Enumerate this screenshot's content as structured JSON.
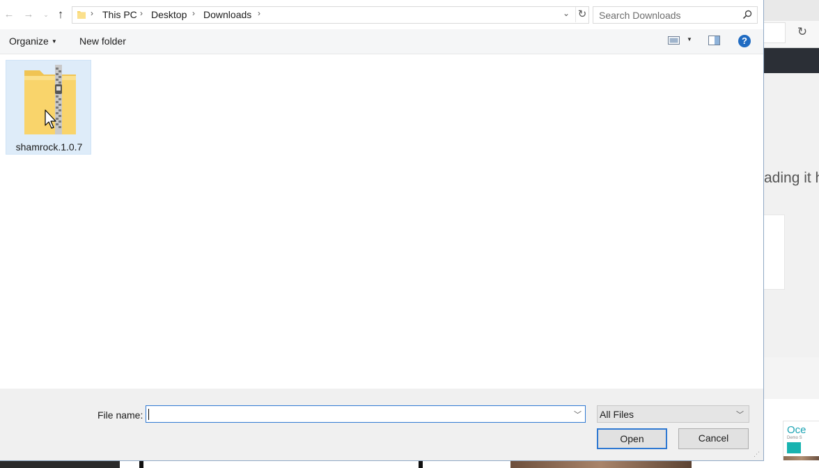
{
  "nav": {
    "back": "←",
    "forward": "→",
    "recent": "⌄",
    "up": "↑"
  },
  "address": {
    "crumbs": [
      "This PC",
      "Desktop",
      "Downloads"
    ],
    "refresh": "↻"
  },
  "search": {
    "placeholder": "Search Downloads"
  },
  "commandbar": {
    "organize": "Organize",
    "new_folder": "New folder",
    "help": "?"
  },
  "files": [
    {
      "name": "shamrock.1.0.7",
      "type": "zip-folder",
      "selected": true
    }
  ],
  "bottom": {
    "file_name_label": "File name:",
    "file_name_value": "",
    "file_type": "All Files",
    "open_label": "Open",
    "cancel_label": "Cancel"
  },
  "background": {
    "page_text": "ading it h",
    "thumb_title": "Oce",
    "thumb_sub": "Demo S"
  },
  "colors": {
    "accent": "#2e78d2",
    "selection": "#deecf9",
    "help": "#1f6bc2",
    "folder": "#f9d46b"
  }
}
